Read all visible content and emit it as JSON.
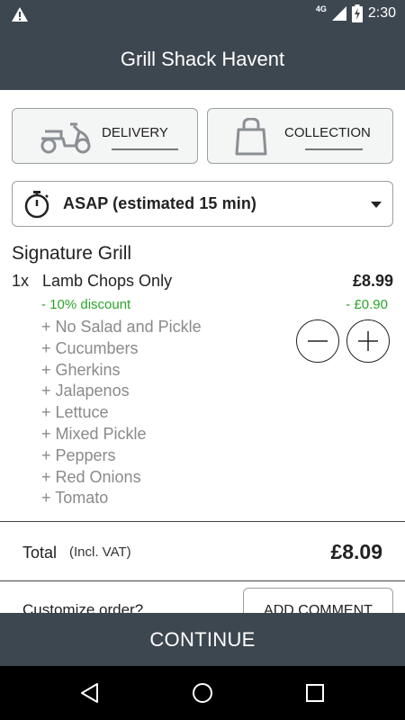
{
  "status_bar": {
    "network": "4G",
    "time": "2:30",
    "icons": [
      "warning-icon",
      "signal-icon",
      "battery-charging-icon"
    ]
  },
  "app_bar": {
    "title": "Grill Shack Havent"
  },
  "order_modes": [
    {
      "label": "DELIVERY",
      "icon": "scooter-icon",
      "selected": false
    },
    {
      "label": "COLLECTION",
      "icon": "shopping-bag-icon",
      "selected": false
    }
  ],
  "schedule": {
    "label": "ASAP (estimated 15 min)",
    "icon": "stopwatch-icon"
  },
  "section": {
    "title": "Signature Grill",
    "item": {
      "qty": "1x",
      "name": "Lamb Chops Only",
      "price": "£8.99",
      "discount_label": "- 10% discount",
      "discount_amount": "- £0.90",
      "modifiers": [
        "+ No Salad and Pickle",
        "+ Cucumbers",
        "+ Gherkins",
        "+ Jalapenos",
        "+ Lettuce",
        "+ Mixed Pickle",
        "+ Peppers",
        "+ Red Onions",
        "+ Tomato"
      ]
    }
  },
  "total": {
    "label": "Total",
    "vat_note": "(Incl. VAT)",
    "value": "£8.09"
  },
  "customize": {
    "question": "Customize order?",
    "button": "ADD COMMENT"
  },
  "continue_label": "CONTINUE",
  "colors": {
    "bar": "#3d4750",
    "discount": "#2aa52a",
    "modifier": "#8a8a8a"
  }
}
